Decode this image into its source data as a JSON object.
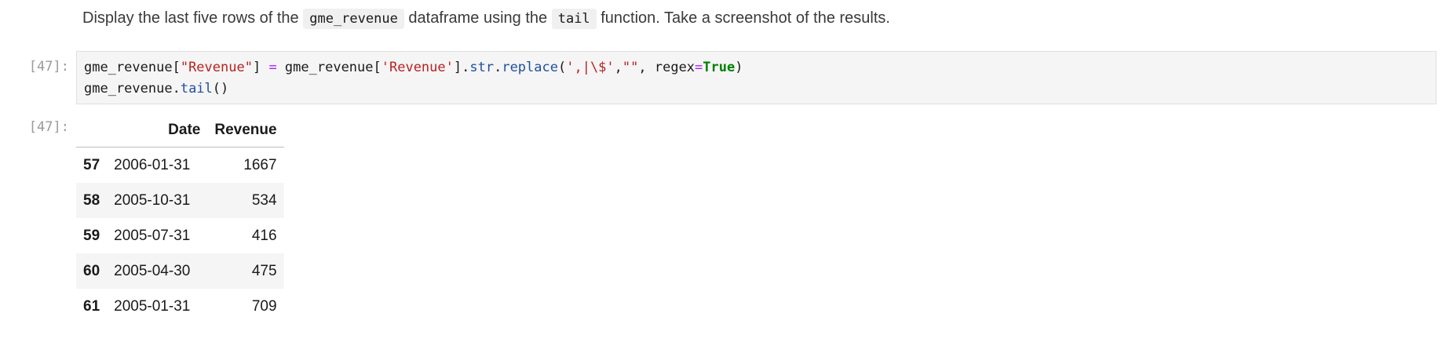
{
  "markdown": {
    "text_1": "Display the last five rows of the ",
    "code_1": "gme_revenue",
    "text_2": " dataframe using the ",
    "code_2": "tail",
    "text_3": " function. Take a screenshot of the results."
  },
  "code_cell": {
    "prompt": "[47]:",
    "line1": {
      "t1": "gme_revenue[",
      "s1": "\"Revenue\"",
      "t2": "] ",
      "op": "=",
      "t3": " gme_revenue[",
      "s2": "'Revenue'",
      "t4": "].",
      "a1": "str",
      "t5": ".",
      "a2": "replace",
      "t6": "(",
      "s3": "',|\\$'",
      "t7": ",",
      "s4": "\"\"",
      "t8": ", regex",
      "op2": "=",
      "kw": "True",
      "t9": ")"
    },
    "line2": {
      "t1": "gme_revenue.",
      "a1": "tail",
      "t2": "()"
    }
  },
  "output": {
    "prompt": "[47]:",
    "columns": [
      "",
      "Date",
      "Revenue"
    ],
    "rows": [
      {
        "index": "57",
        "date": "2006-01-31",
        "revenue": "1667"
      },
      {
        "index": "58",
        "date": "2005-10-31",
        "revenue": "534"
      },
      {
        "index": "59",
        "date": "2005-07-31",
        "revenue": "416"
      },
      {
        "index": "60",
        "date": "2005-04-30",
        "revenue": "475"
      },
      {
        "index": "61",
        "date": "2005-01-31",
        "revenue": "709"
      }
    ]
  }
}
